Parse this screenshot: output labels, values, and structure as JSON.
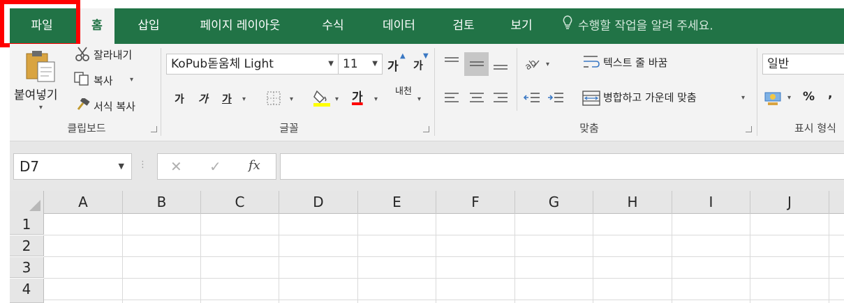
{
  "tabs": [
    "파일",
    "홈",
    "삽입",
    "페이지 레이아웃",
    "수식",
    "데이터",
    "검토",
    "보기"
  ],
  "active_tab": "홈",
  "highlighted_tab": "파일",
  "tell_me": "수행할 작업을 알려 주세요.",
  "clipboard": {
    "paste_label": "붙여넣기",
    "cut_label": "잘라내기",
    "copy_label": "복사",
    "format_painter_label": "서식 복사",
    "group_label": "클립보드"
  },
  "font": {
    "font_name": "KoPub돋움체 Light",
    "font_size": "11",
    "increase_size_icon": "가",
    "decrease_size_icon": "가",
    "bold_label": "가",
    "italic_label": "가",
    "underline_label": "가",
    "font_color_label": "가",
    "phonetic_label": "내천",
    "group_label": "글꼴"
  },
  "alignment": {
    "wrap_text_label": "텍스트 줄 바꿈",
    "merge_center_label": "병합하고 가운데 맞춤",
    "group_label": "맞춤"
  },
  "number": {
    "format_value": "일반",
    "percent_label": "%",
    "comma_label": ",",
    "group_label": "표시 형식"
  },
  "formula_bar": {
    "name_box": "D7",
    "cancel_icon": "✕",
    "enter_icon": "✓",
    "fx_label": "fx",
    "formula_value": ""
  },
  "columns": [
    "A",
    "B",
    "C",
    "D",
    "E",
    "F",
    "G",
    "H",
    "I",
    "J"
  ],
  "rows": [
    "1",
    "2",
    "3",
    "4"
  ],
  "colors": {
    "accent": "#217346",
    "highlight": "#ff0000",
    "fill_yellow": "#ffff00",
    "font_red": "#ff0000"
  }
}
